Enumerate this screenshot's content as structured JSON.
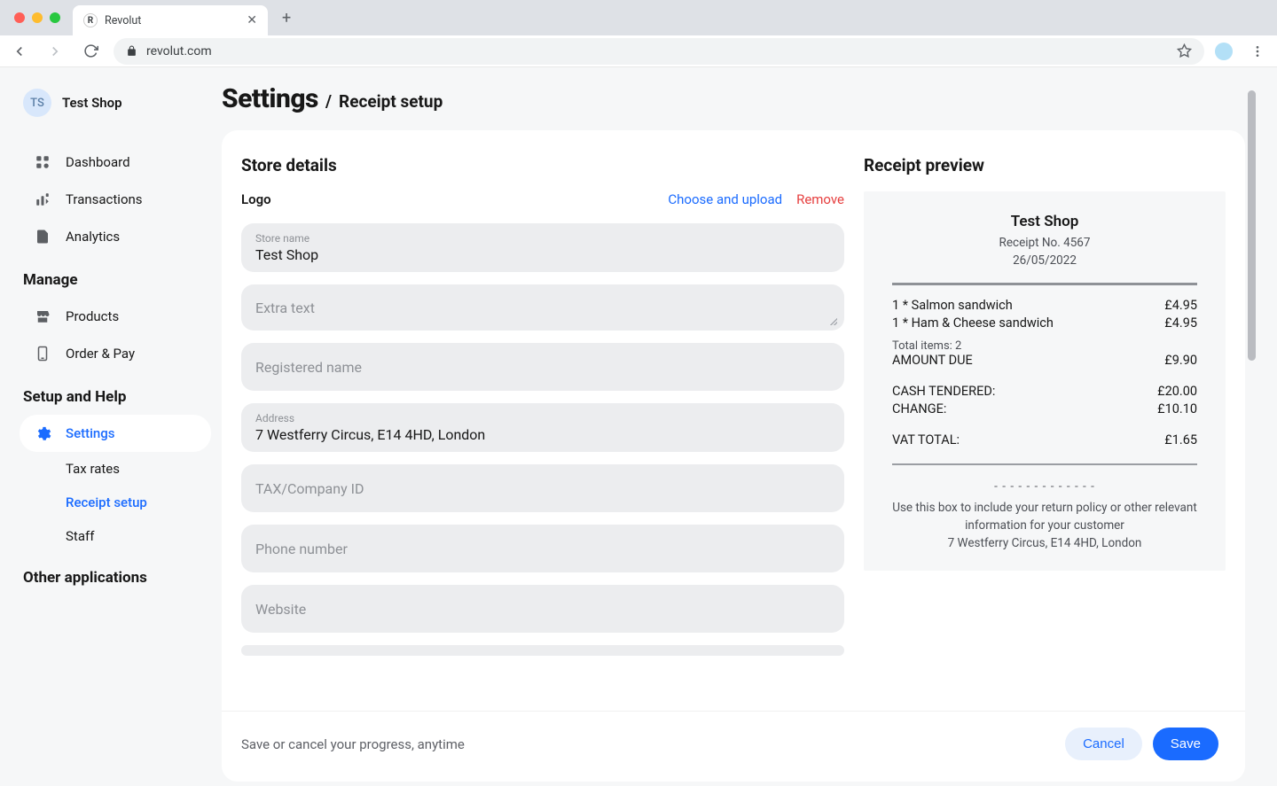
{
  "browser": {
    "tab_title": "Revolut",
    "url": "revolut.com"
  },
  "sidebar": {
    "shop_initials": "TS",
    "shop_name": "Test Shop",
    "nav": [
      {
        "label": "Dashboard",
        "icon": "grid"
      },
      {
        "label": "Transactions",
        "icon": "stats"
      },
      {
        "label": "Analytics",
        "icon": "doc"
      }
    ],
    "section_manage": "Manage",
    "manage": [
      {
        "label": "Products",
        "icon": "store"
      },
      {
        "label": "Order & Pay",
        "icon": "phone"
      }
    ],
    "section_setup": "Setup and Help",
    "setup": {
      "settings_label": "Settings",
      "subs": [
        {
          "label": "Tax rates",
          "active": false
        },
        {
          "label": "Receipt setup",
          "active": true
        },
        {
          "label": "Staff",
          "active": false
        }
      ]
    },
    "section_other": "Other applications"
  },
  "header": {
    "title": "Settings",
    "separator": "/",
    "subtitle": "Receipt setup"
  },
  "store_details": {
    "heading": "Store details",
    "logo_label": "Logo",
    "upload_label": "Choose and upload",
    "remove_label": "Remove",
    "fields": {
      "store_name_label": "Store name",
      "store_name_value": "Test Shop",
      "extra_text_placeholder": "Extra text",
      "registered_name_placeholder": "Registered name",
      "address_label": "Address",
      "address_value": "7 Westferry Circus, E14 4HD, London",
      "tax_placeholder": "TAX/Company ID",
      "phone_placeholder": "Phone number",
      "website_placeholder": "Website"
    }
  },
  "receipt_preview": {
    "heading": "Receipt preview",
    "shop_name": "Test Shop",
    "receipt_no": "Receipt No. 4567",
    "date": "26/05/2022",
    "items": [
      {
        "desc": "1 * Salmon sandwich",
        "price": "£4.95"
      },
      {
        "desc": "1 * Ham & Cheese sandwich",
        "price": "£4.95"
      }
    ],
    "total_items": "Total items: 2",
    "amount_due_label": "AMOUNT DUE",
    "amount_due_value": "£9.90",
    "cash_label": "CASH TENDERED:",
    "cash_value": "£20.00",
    "change_label": "CHANGE:",
    "change_value": "£10.10",
    "vat_label": "VAT TOTAL:",
    "vat_value": "£1.65",
    "footer_text": "Use this box to include your return policy or other relevant information for your customer",
    "footer_address": "7 Westferry Circus, E14 4HD, London"
  },
  "footer": {
    "text": "Save or cancel your progress, anytime",
    "cancel": "Cancel",
    "save": "Save"
  }
}
